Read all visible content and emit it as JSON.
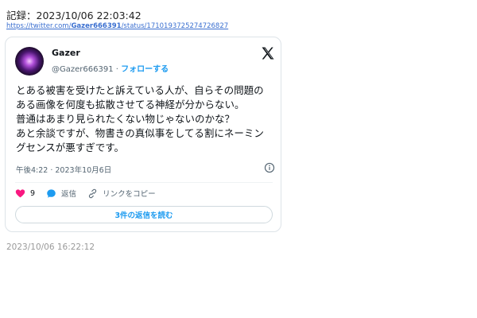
{
  "record": {
    "label": "記録：2023/10/06 22:03:42",
    "url_prefix": "https://twitter.com/",
    "url_user": "Gazer666391",
    "url_suffix": "/status/1710193725274726827"
  },
  "tweet": {
    "display_name": "Gazer",
    "handle": "@Gazer666391",
    "separator": " · ",
    "follow_label": "フォローする",
    "lines": [
      "とある被害を受けたと訴えている人が、自らその問題の",
      "ある画像を何度も拡散させてる神経が分からない。",
      "普通はあまり見られたくない物じゃないのかな？",
      "あと余談ですが、物書きの真似事をしてる割にネーミン",
      "グセンスが悪すぎです。"
    ],
    "timestamp": "午後4:22 · 2023年10月6日",
    "like_count": "9",
    "reply_label": "返信",
    "copy_link_label": "リンクをコピー",
    "read_replies_label": "3件の返信を読む"
  },
  "archive_timestamp": "2023/10/06 16:22:12",
  "icons": {
    "logo": "x-logo-icon",
    "info": "info-icon",
    "like": "heart-icon",
    "reply": "speech-bubble-icon",
    "link": "link-icon"
  },
  "colors": {
    "accent": "#1d9bf0",
    "like": "#f91880",
    "secondary_text": "#536471"
  }
}
